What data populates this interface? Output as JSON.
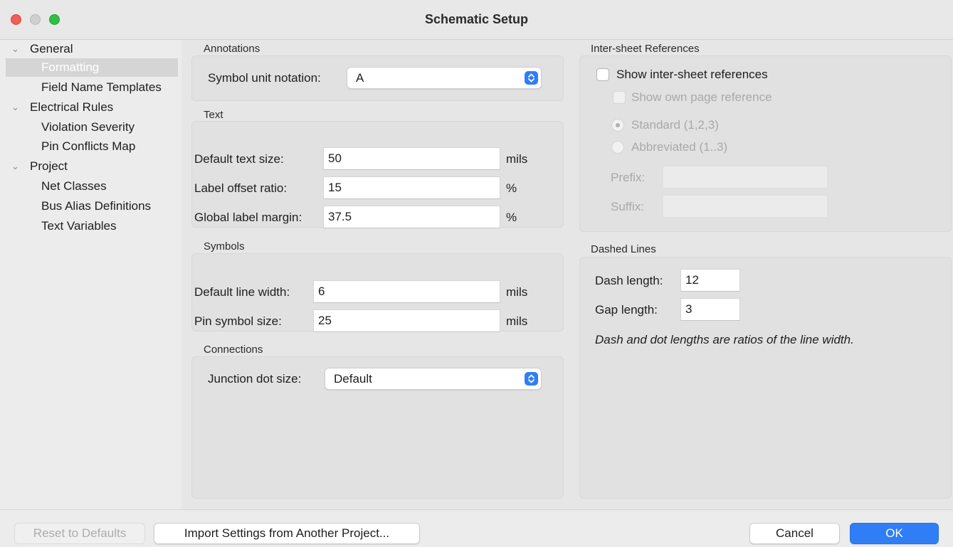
{
  "window": {
    "title": "Schematic Setup"
  },
  "sidebar": {
    "items": [
      {
        "label": "General",
        "level": 0,
        "expanded": true
      },
      {
        "label": "Formatting",
        "level": 1,
        "selected": true
      },
      {
        "label": "Field Name Templates",
        "level": 1
      },
      {
        "label": "Electrical Rules",
        "level": 0,
        "expanded": true
      },
      {
        "label": "Violation Severity",
        "level": 1
      },
      {
        "label": "Pin Conflicts Map",
        "level": 1
      },
      {
        "label": "Project",
        "level": 0,
        "expanded": true
      },
      {
        "label": "Net Classes",
        "level": 1
      },
      {
        "label": "Bus Alias Definitions",
        "level": 1
      },
      {
        "label": "Text Variables",
        "level": 1
      }
    ]
  },
  "annotations": {
    "title": "Annotations",
    "symbol_unit_label": "Symbol unit notation:",
    "symbol_unit_value": "A"
  },
  "text": {
    "title": "Text",
    "default_text_size_label": "Default text size:",
    "default_text_size_value": "50",
    "default_text_size_unit": "mils",
    "label_offset_label": "Label offset ratio:",
    "label_offset_value": "15",
    "label_offset_unit": "%",
    "global_label_margin_label": "Global label margin:",
    "global_label_margin_value": "37.5",
    "global_label_margin_unit": "%"
  },
  "symbols": {
    "title": "Symbols",
    "default_line_width_label": "Default line width:",
    "default_line_width_value": "6",
    "default_line_width_unit": "mils",
    "pin_symbol_size_label": "Pin symbol size:",
    "pin_symbol_size_value": "25",
    "pin_symbol_size_unit": "mils"
  },
  "connections": {
    "title": "Connections",
    "junction_dot_label": "Junction dot size:",
    "junction_dot_value": "Default"
  },
  "intersheet": {
    "title": "Inter-sheet References",
    "show_refs_label": "Show inter-sheet references",
    "show_refs_checked": false,
    "show_own_page_label": "Show own page reference",
    "standard_label": "Standard (1,2,3)",
    "abbreviated_label": "Abbreviated (1..3)",
    "prefix_label": "Prefix:",
    "prefix_value": "",
    "suffix_label": "Suffix:",
    "suffix_value": ""
  },
  "dashed": {
    "title": "Dashed Lines",
    "dash_length_label": "Dash length:",
    "dash_length_value": "12",
    "gap_length_label": "Gap length:",
    "gap_length_value": "3",
    "note": "Dash and dot lengths are ratios of the line width."
  },
  "footer": {
    "reset_label": "Reset to Defaults",
    "import_label": "Import Settings from Another Project...",
    "cancel_label": "Cancel",
    "ok_label": "OK"
  },
  "colors": {
    "accent": "#2f7ef6",
    "close": "#ee5f57",
    "zoom": "#2fbf44"
  }
}
